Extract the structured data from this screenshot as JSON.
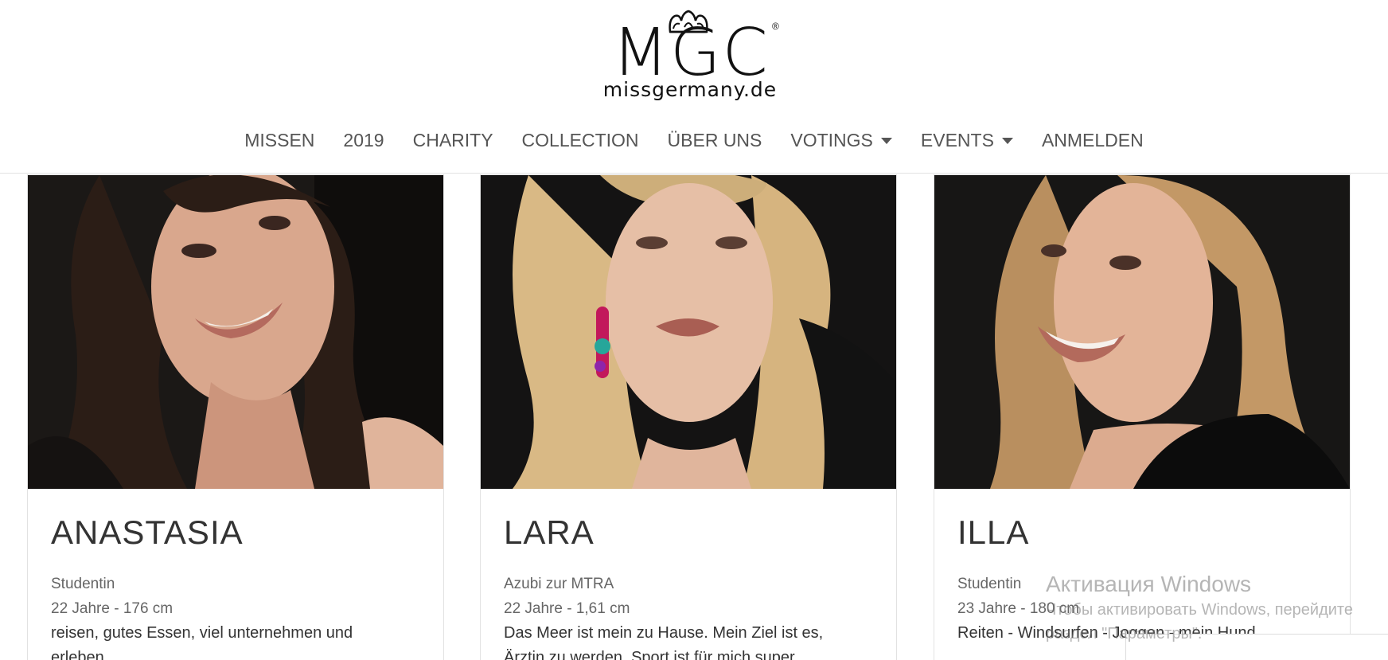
{
  "logo": {
    "wordmark": "MGC",
    "registered": "®",
    "domain": "missgermany.de"
  },
  "nav": {
    "items": [
      {
        "label": "MISSEN",
        "dropdown": false
      },
      {
        "label": "2019",
        "dropdown": false
      },
      {
        "label": "CHARITY",
        "dropdown": false
      },
      {
        "label": "COLLECTION",
        "dropdown": false
      },
      {
        "label": "ÜBER UNS",
        "dropdown": false
      },
      {
        "label": "VOTINGS",
        "dropdown": true
      },
      {
        "label": "EVENTS",
        "dropdown": true
      },
      {
        "label": "ANMELDEN",
        "dropdown": false
      }
    ]
  },
  "cards": [
    {
      "name": "ANASTASIA",
      "job": "Studentin",
      "stats": "22 Jahre - 176 cm",
      "hobbies_line1": "reisen, gutes Essen, viel unternehmen und",
      "hobbies_line2": "erleben"
    },
    {
      "name": "LARA",
      "job": "Azubi zur MTRA",
      "stats": "22 Jahre - 1,61 cm",
      "hobbies_line1": "Das Meer ist mein zu Hause. Mein Ziel ist es,",
      "hobbies_line2": "Ärztin zu werden. Sport ist für mich super"
    },
    {
      "name": "ILLA",
      "job": "Studentin",
      "stats": "23 Jahre - 180 cm",
      "hobbies_line1": "Reiten - Windsurfen - Joggen - mein Hund",
      "hobbies_line2": ""
    }
  ],
  "watermark": {
    "title": "Активация Windows",
    "line1": "Чтобы активировать Windows, перейдите",
    "line2": "раздел \"Параметры\"."
  },
  "colors": {
    "nav_text": "#555555",
    "photo_background": "#1a1a1a",
    "card_border": "#e2e2e2"
  }
}
